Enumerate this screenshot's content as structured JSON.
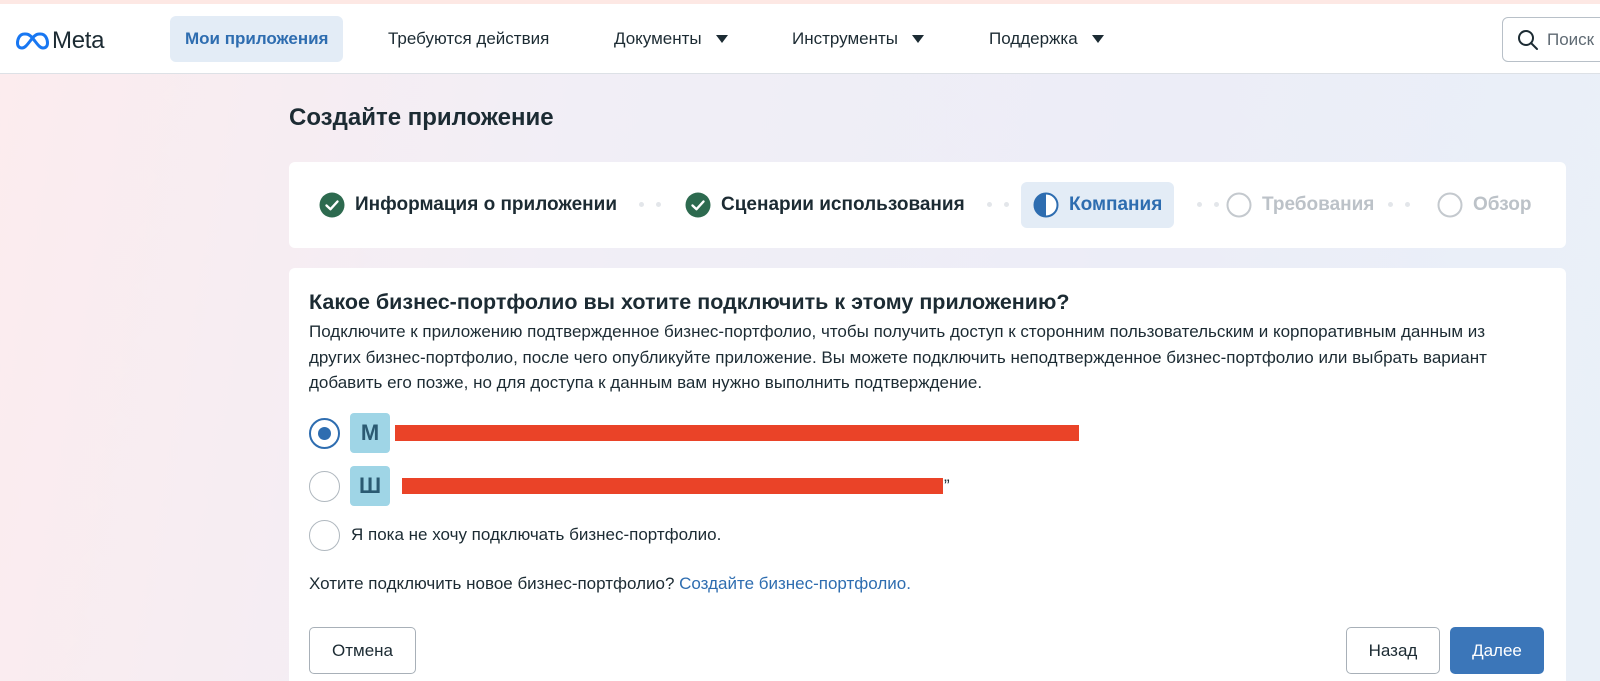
{
  "header": {
    "logo_text": "Meta",
    "nav": [
      {
        "label": "Мои приложения"
      },
      {
        "label": "Требуются действия"
      },
      {
        "label": "Документы"
      },
      {
        "label": "Инструменты"
      },
      {
        "label": "Поддержка"
      }
    ],
    "search_placeholder": "Поиск"
  },
  "page_title": "Создайте приложение",
  "steps": [
    {
      "label": "Информация о приложении",
      "state": "done"
    },
    {
      "label": "Сценарии использования",
      "state": "done"
    },
    {
      "label": "Компания",
      "state": "current"
    },
    {
      "label": "Требования",
      "state": "pending"
    },
    {
      "label": "Обзор",
      "state": "pending"
    }
  ],
  "question": {
    "title": "Какое бизнес-портфолио вы хотите подключить к этому приложению?",
    "description": "Подключите к приложению подтвержденное бизнес-портфолио, чтобы получить доступ к сторонним пользовательским и корпоративным данным из других бизнес-портфолио, после чего опубликуйте приложение. Вы можете подключить неподтвержденное бизнес-портфолио или выбрать вариант добавить его позже, но для доступа к данным вам нужно выполнить подтверждение."
  },
  "options": [
    {
      "avatar": "М",
      "selected": true
    },
    {
      "avatar": "Ш",
      "selected": false,
      "tail": "”"
    },
    {
      "label": "Я пока не хочу подключать бизнес-портфолио.",
      "selected": false
    }
  ],
  "new_portfolio": {
    "text": "Хотите подключить новое бизнес-портфолио?",
    "link": "Создайте бизнес-портфолио."
  },
  "buttons": {
    "cancel": "Отмена",
    "back": "Назад",
    "next": "Далее"
  },
  "colors": {
    "accent": "#2e6db0",
    "primary_button": "#3b76b9",
    "step_done": "#2d6a4f",
    "redaction": "#ea4328"
  }
}
